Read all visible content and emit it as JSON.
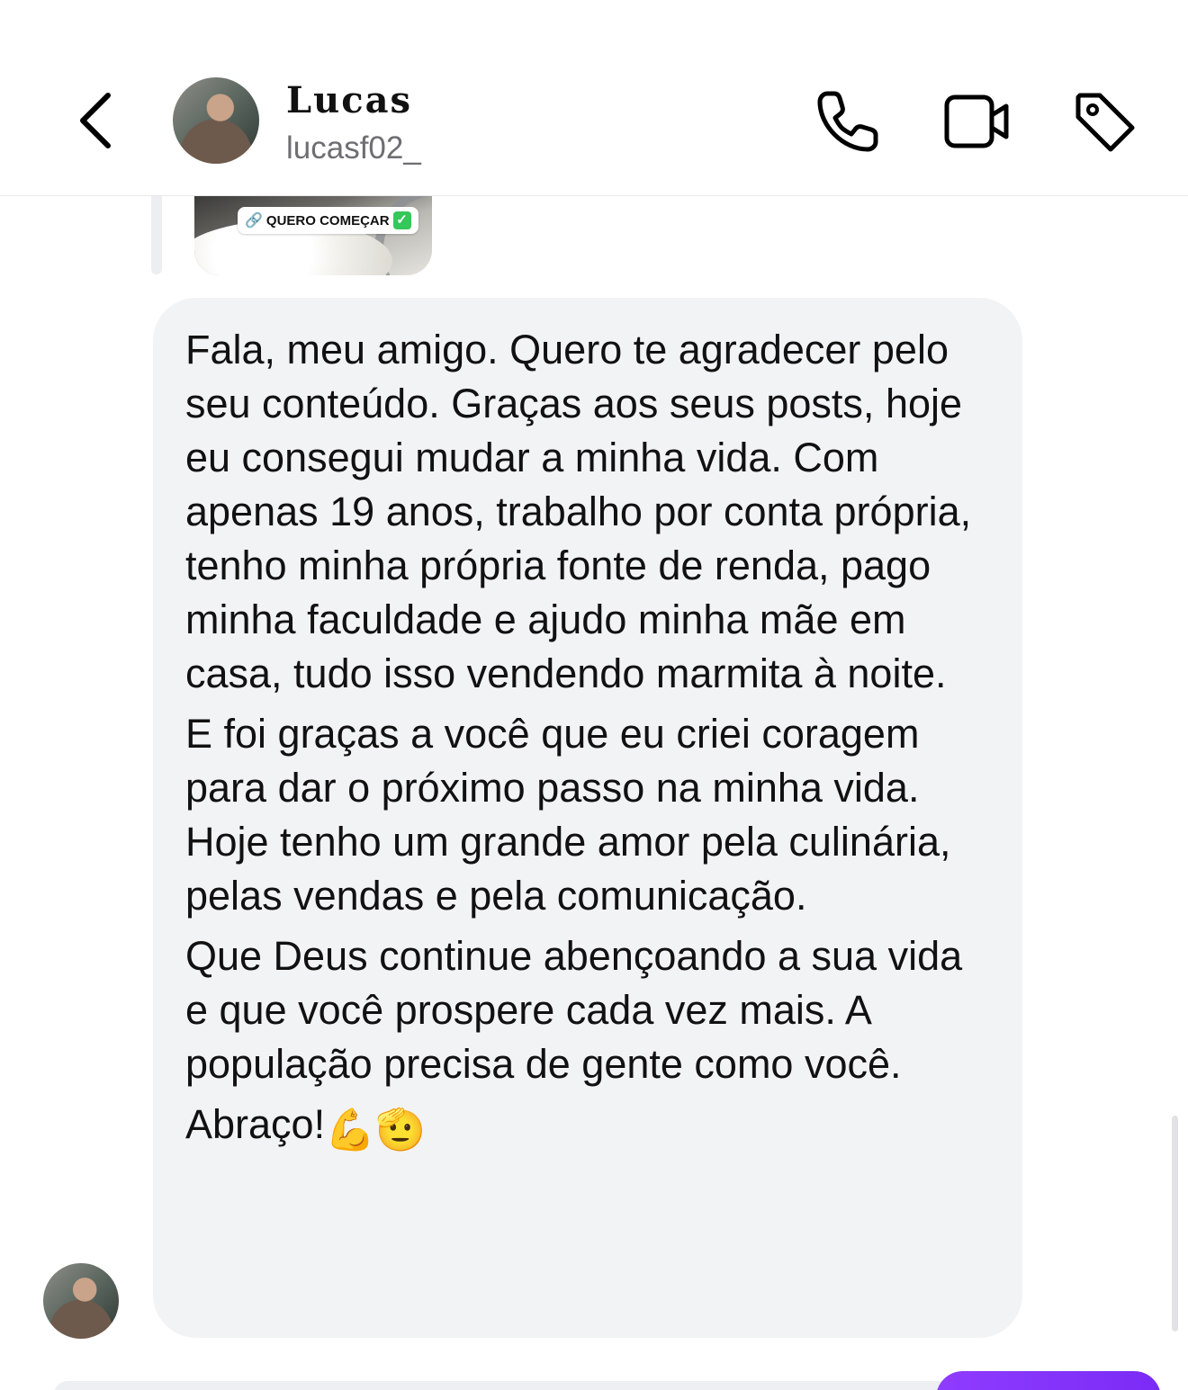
{
  "header": {
    "display_name": "Lucas",
    "username": "lucasf02_",
    "icons": [
      "chevron-left-icon",
      "phone-icon",
      "video-camera-icon",
      "tag-icon"
    ]
  },
  "shared_post": {
    "cta_label": "QUERO COMEÇAR"
  },
  "message": {
    "paragraphs": [
      "Fala, meu amigo. Quero te agradecer pelo seu conteúdo. Graças aos seus posts, hoje eu consegui mudar a minha vida. Com apenas 19 anos, trabalho por conta própria, tenho minha própria fonte de renda, pago minha faculdade e ajudo minha mãe em casa, tudo isso vendendo marmita à noite.",
      "E foi graças a você que eu criei coragem para dar o próximo passo na minha vida. Hoje tenho um grande amor pela culinária, pelas vendas e pela comunicação.",
      "Que Deus continue abençoando a sua vida e que você prospere cada vez mais. A população precisa de gente como você."
    ],
    "closing": "Abraço!",
    "closing_emojis": "💪🫡"
  },
  "colors": {
    "bubble_bg": "#f2f3f5",
    "accent_purple": "#8f3cff"
  }
}
